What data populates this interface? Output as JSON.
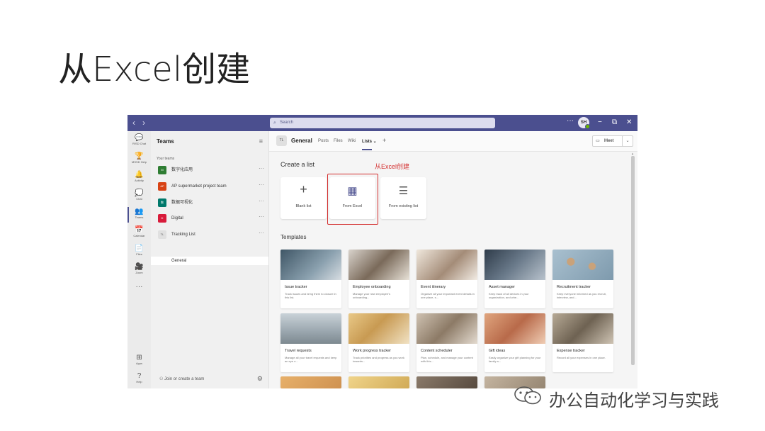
{
  "slide": {
    "title": "从Excel创建"
  },
  "titlebar": {
    "back": "‹",
    "forward": "›",
    "search_placeholder": "Search",
    "more": "···",
    "avatar_initials": "SH",
    "minimize": "−",
    "restore": "⧉",
    "close": "✕"
  },
  "rail": [
    {
      "icon": "💬",
      "label": "RISD Chat"
    },
    {
      "icon": "🏆",
      "label": "MSSD Help"
    },
    {
      "icon": "🔔",
      "label": "Activity"
    },
    {
      "icon": "💭",
      "label": "Chat"
    },
    {
      "icon": "👥",
      "label": "Teams"
    },
    {
      "icon": "📅",
      "label": "Calendar"
    },
    {
      "icon": "📄",
      "label": "Files"
    },
    {
      "icon": "🎥",
      "label": "Zoom"
    },
    {
      "icon": "···",
      "label": ""
    },
    {
      "icon": "⊞",
      "label": "Apps"
    },
    {
      "icon": "?",
      "label": "Help"
    }
  ],
  "teams_panel": {
    "title": "Teams",
    "subtitle": "Your teams",
    "teams": [
      {
        "initials": "M",
        "name": "数字化应用",
        "color": "#2e7d32"
      },
      {
        "initials": "AP",
        "name": "AP supermarket project team",
        "color": "#d84315"
      },
      {
        "initials": "数",
        "name": "数据可视化",
        "color": "#00796b"
      },
      {
        "initials": "D",
        "name": "Digital",
        "color": "#d81b3a"
      },
      {
        "initials": "TL",
        "name": "Tracking List",
        "color": "#e0e0e0"
      }
    ],
    "more": "···",
    "channel": "General",
    "join": "Join or create a team"
  },
  "channel_header": {
    "badge": "TL",
    "name": "General",
    "tabs": [
      "Posts",
      "Files",
      "Wiki",
      "Lists ⌄"
    ],
    "add": "+",
    "meet": "Meet",
    "meet_caret": "⌄"
  },
  "create": {
    "heading": "Create a list",
    "annotation": "从Excel创建",
    "options": [
      {
        "icon": "+",
        "label": "Blank list"
      },
      {
        "icon": "▦",
        "label": "From Excel"
      },
      {
        "icon": "☰",
        "label": "From existing list"
      }
    ]
  },
  "templates": {
    "heading": "Templates",
    "items": [
      {
        "title": "Issue tracker",
        "desc": "Track issues and bring them to closure in this list.",
        "color": "#6d7f8c"
      },
      {
        "title": "Employee onboarding",
        "desc": "Manage your new employee's onboarding...",
        "color": "#8a7a6a"
      },
      {
        "title": "Event itinerary",
        "desc": "Organize all your important event details in one place, s...",
        "color": "#b8a89a"
      },
      {
        "title": "Asset manager",
        "desc": "Keep track of all devices in your organization, and whe...",
        "color": "#5a6a7a"
      },
      {
        "title": "Recruitment tracker",
        "desc": "Keep everyone informed as you recruit, interview, and...",
        "color": "#9fb3c2"
      },
      {
        "title": "Travel requests",
        "desc": "Manage all your travel requests and keep an eye o...",
        "color": "#a9b4bd"
      },
      {
        "title": "Work progress tracker",
        "desc": "Track priorities and progress as you work towards...",
        "color": "#c9a66a"
      },
      {
        "title": "Content scheduler",
        "desc": "Plan, schedule, and manage your content with this...",
        "color": "#9a8a7a"
      },
      {
        "title": "Gift ideas",
        "desc": "Easily organize your gift planning for your family a...",
        "color": "#c98a6a"
      },
      {
        "title": "Expense tracker",
        "desc": "Record all your expenses in one place.",
        "color": "#8a8070"
      }
    ],
    "bottom_row_colors": [
      "#c98a4a",
      "#d0b060",
      "#7a6a5a",
      "#a09080"
    ]
  },
  "watermark": {
    "text": "办公自动化学习与实践",
    "icon": "wechat-icon"
  }
}
